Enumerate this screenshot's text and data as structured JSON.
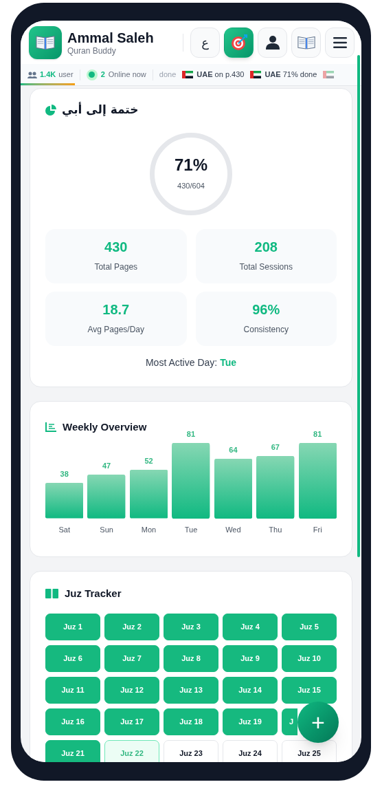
{
  "app": {
    "name": "Ammal Saleh",
    "subtitle": "Quran Buddy"
  },
  "header_buttons": [
    {
      "kind": "letter",
      "label": "ع",
      "selected": false
    },
    {
      "kind": "target",
      "selected": true
    },
    {
      "kind": "user",
      "selected": false
    },
    {
      "kind": "book",
      "selected": false
    },
    {
      "kind": "menu",
      "selected": false
    }
  ],
  "ticker": {
    "users_count": "1.4K",
    "users_label": "user",
    "online_count": "2",
    "online_label": "Online now",
    "items": [
      {
        "kind": "text",
        "text": "done"
      },
      {
        "kind": "flag",
        "text": "**UAE** on p.430"
      },
      {
        "kind": "flag",
        "text": "**UAE** 71% done"
      },
      {
        "kind": "flag_only"
      }
    ]
  },
  "page_progress": {
    "level": 0.16
  },
  "khatma": {
    "title": "ختمة إلى أبي",
    "percent": "71%",
    "pages": "430/604",
    "stats": [
      {
        "value": "430",
        "label": "Total Pages"
      },
      {
        "value": "208",
        "label": "Total Sessions"
      },
      {
        "value": "18.7",
        "label": "Avg Pages/Day"
      },
      {
        "value": "96%",
        "label": "Consistency"
      }
    ],
    "most_active_label": "Most Active Day:",
    "most_active_value": "Tue"
  },
  "weekly": {
    "title": "Weekly Overview",
    "chart_data": {
      "type": "bar",
      "categories": [
        "Sat",
        "Sun",
        "Mon",
        "Tue",
        "Wed",
        "Thu",
        "Fri"
      ],
      "values": [
        38,
        47,
        52,
        81,
        64,
        67,
        81
      ],
      "data_labels": true
    }
  },
  "juz": {
    "title": "Juz Tracker",
    "items": [
      {
        "label": "Juz 1",
        "kind": "done"
      },
      {
        "label": "Juz 2",
        "kind": "done"
      },
      {
        "label": "Juz 3",
        "kind": "done"
      },
      {
        "label": "Juz 4",
        "kind": "done"
      },
      {
        "label": "Juz 5",
        "kind": "done"
      },
      {
        "label": "Juz 6",
        "kind": "done"
      },
      {
        "label": "Juz 7",
        "kind": "done"
      },
      {
        "label": "Juz 8",
        "kind": "done"
      },
      {
        "label": "Juz 9",
        "kind": "done"
      },
      {
        "label": "Juz 10",
        "kind": "done"
      },
      {
        "label": "Juz 11",
        "kind": "done"
      },
      {
        "label": "Juz 12",
        "kind": "done"
      },
      {
        "label": "Juz 13",
        "kind": "done"
      },
      {
        "label": "Juz 14",
        "kind": "done"
      },
      {
        "label": "Juz 15",
        "kind": "done"
      },
      {
        "label": "Juz 16",
        "kind": "done"
      },
      {
        "label": "Juz 17",
        "kind": "done"
      },
      {
        "label": "Juz 18",
        "kind": "done"
      },
      {
        "label": "Juz 19",
        "kind": "done"
      },
      {
        "label": "J",
        "kind": "done"
      },
      {
        "label": "Juz 21",
        "kind": "done"
      },
      {
        "label": "Juz 22",
        "kind": "partial"
      },
      {
        "label": "Juz 23",
        "kind": "none"
      },
      {
        "label": "Juz 24",
        "kind": "none"
      },
      {
        "label": "Juz 25",
        "kind": "none"
      }
    ]
  },
  "fab": {
    "label": "+"
  }
}
